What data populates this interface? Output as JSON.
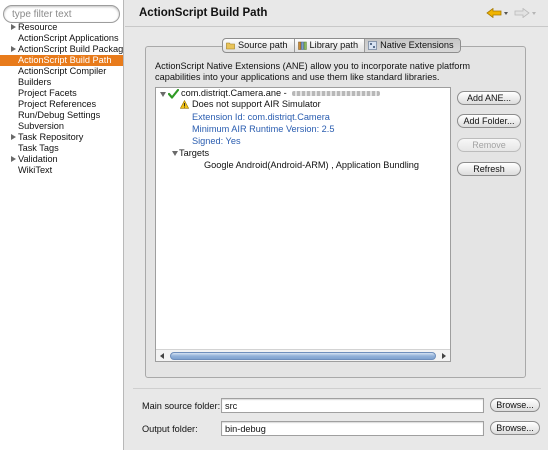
{
  "left_panel": {
    "filter_placeholder": "type filter text",
    "tree": [
      {
        "label": "Resource",
        "expandable": true,
        "selected": false
      },
      {
        "label": "ActionScript Applications",
        "expandable": false,
        "selected": false
      },
      {
        "label": "ActionScript Build Packaging",
        "expandable": true,
        "selected": false
      },
      {
        "label": "ActionScript Build Path",
        "expandable": false,
        "selected": true
      },
      {
        "label": "ActionScript Compiler",
        "expandable": false,
        "selected": false
      },
      {
        "label": "Builders",
        "expandable": false,
        "selected": false
      },
      {
        "label": "Project Facets",
        "expandable": false,
        "selected": false
      },
      {
        "label": "Project References",
        "expandable": false,
        "selected": false
      },
      {
        "label": "Run/Debug Settings",
        "expandable": false,
        "selected": false
      },
      {
        "label": "Subversion",
        "expandable": false,
        "selected": false
      },
      {
        "label": "Task Repository",
        "expandable": true,
        "selected": false
      },
      {
        "label": "Task Tags",
        "expandable": false,
        "selected": false
      },
      {
        "label": "Validation",
        "expandable": true,
        "selected": false
      },
      {
        "label": "WikiText",
        "expandable": false,
        "selected": false
      }
    ]
  },
  "page": {
    "title": "ActionScript Build Path",
    "tabs": [
      {
        "label": "Source path",
        "icon": "folder-icon",
        "active": false
      },
      {
        "label": "Library path",
        "icon": "library-icon",
        "active": false
      },
      {
        "label": "Native Extensions",
        "icon": "extension-icon",
        "active": true
      }
    ],
    "description": "ActionScript Native Extensions (ANE) allow you to incorporate native platform capabilities into your applications and use them like standard libraries.",
    "extension": {
      "name": "com.distriqt.Camera.ane -",
      "warning": "Does not support AIR Simulator",
      "extension_id": "Extension Id: com.distriqt.Camera",
      "min_runtime": "Minimum AIR Runtime Version: 2.5",
      "signed": "Signed: Yes",
      "targets_label": "Targets",
      "targets_value": "Google Android(Android-ARM) , Application Bundling"
    },
    "buttons": {
      "add_ane": "Add ANE...",
      "add_folder": "Add Folder...",
      "remove": "Remove",
      "refresh": "Refresh"
    },
    "main_source_label": "Main source folder:",
    "main_source_value": "src",
    "output_label": "Output folder:",
    "output_value": "bin-debug",
    "browse_label": "Browse...",
    "colors": {
      "selection": "#e87b1b",
      "link_blue": "#2a5db0"
    }
  }
}
